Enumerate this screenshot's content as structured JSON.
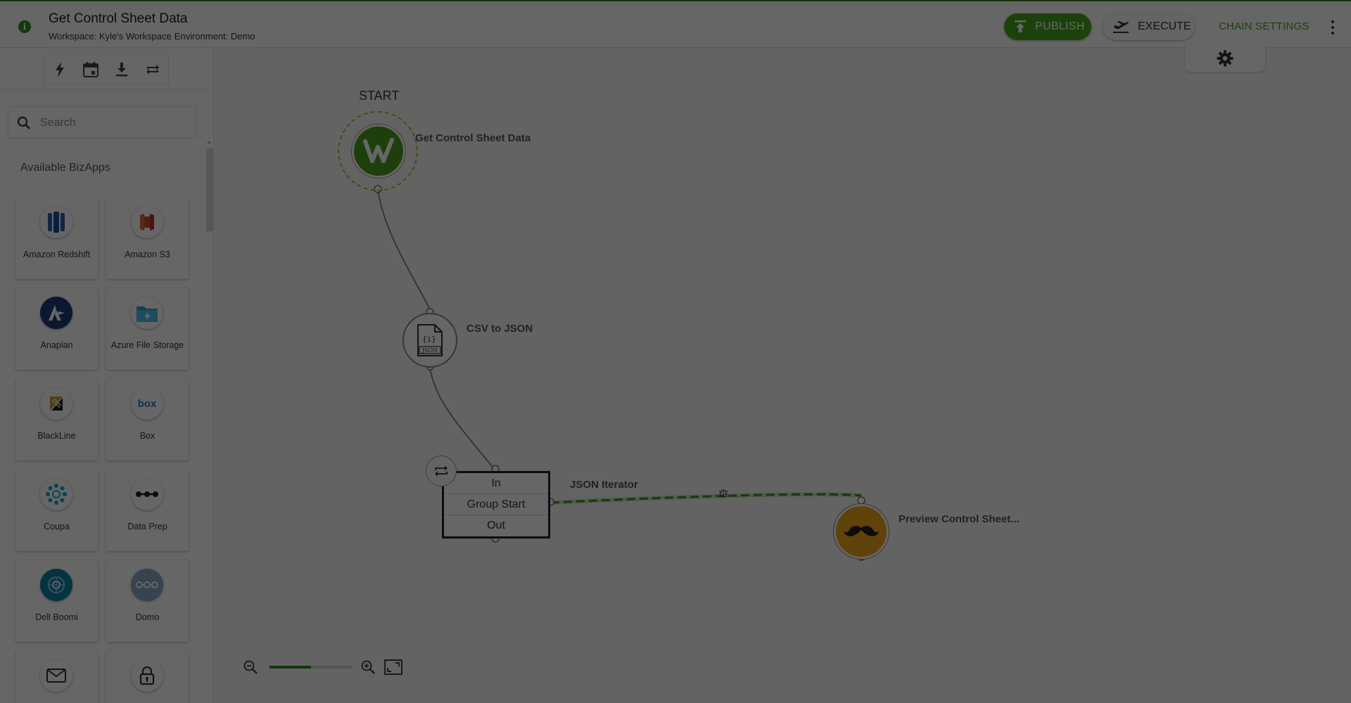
{
  "header": {
    "title": "Get Control Sheet Data",
    "workspace": "Workspace: Kyle's Workspace",
    "environment": "Environment: Demo",
    "publish_label": "PUBLISH",
    "execute_label": "EXECUTE",
    "chain_settings_label": "CHAIN SETTINGS"
  },
  "sidebar": {
    "search_placeholder": "Search",
    "section_title": "Available BizApps",
    "bizapps": [
      {
        "label": "Amazon Redshift",
        "icon": "amazon-redshift-icon",
        "color": "#2a63b0"
      },
      {
        "label": "Amazon S3",
        "icon": "amazon-s3-icon",
        "color": "#d2452d"
      },
      {
        "label": "Anaplan",
        "icon": "anaplan-icon",
        "color": "#1f3a78"
      },
      {
        "label": "Azure File Storage",
        "icon": "azure-file-storage-icon",
        "color": "#2fa3d8"
      },
      {
        "label": "BlackLine",
        "icon": "blackline-icon",
        "color": "#c7a233"
      },
      {
        "label": "Box",
        "icon": "box-icon",
        "color": "#1e78d2"
      },
      {
        "label": "Coupa",
        "icon": "coupa-icon",
        "color": "#1aa4d8"
      },
      {
        "label": "Data Prep",
        "icon": "data-prep-icon",
        "color": "#222222"
      },
      {
        "label": "Dell Boomi",
        "icon": "dell-boomi-icon",
        "color": "#0f7fa0"
      },
      {
        "label": "Domo",
        "icon": "domo-icon",
        "color": "#8aa9c2"
      },
      {
        "label": "",
        "icon": "email-icon",
        "color": "#333333"
      },
      {
        "label": "",
        "icon": "lock-icon",
        "color": "#333333"
      }
    ]
  },
  "canvas": {
    "start_label": "START",
    "nodes": {
      "start_node_label": "Get Control Sheet Data",
      "csv_node_label": "CSV to JSON",
      "csv_icon_text": "JSON",
      "iterator_label": "JSON Iterator",
      "preview_node_label": "Preview Control Sheet..."
    },
    "group": {
      "in_label": "In",
      "start_label": "Group Start",
      "out_label": "Out"
    },
    "zoom_level": 0.5
  },
  "colors": {
    "brand_green": "#47a51c",
    "chain_settings": "#4a9e1e",
    "start_node": "#4a9e1e",
    "preview_node": "#f1a51c",
    "overlay": "rgba(0,0,0,0.6)"
  }
}
